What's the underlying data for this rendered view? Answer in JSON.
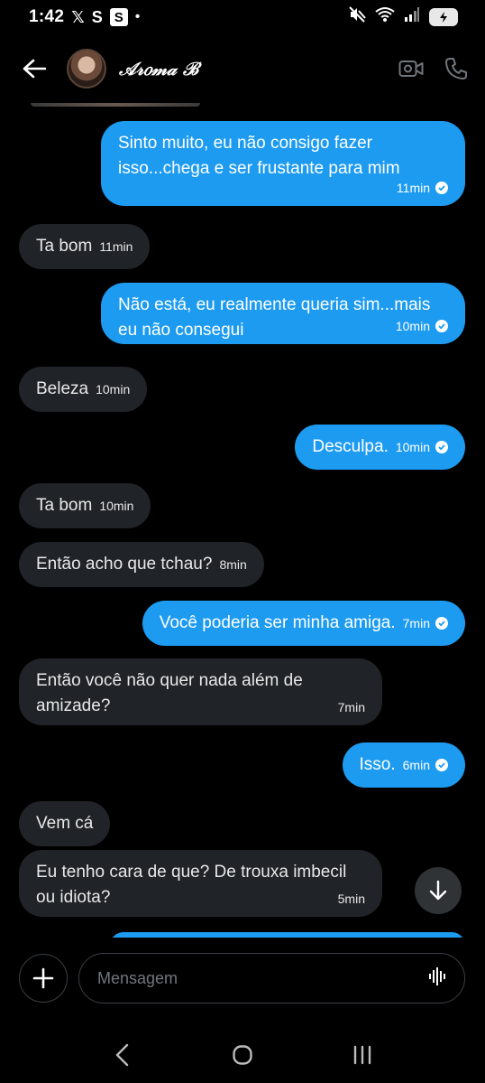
{
  "status_bar": {
    "time": "1:42",
    "icons": [
      "x-logo-icon",
      "s-icon",
      "s-box-icon",
      "dot-icon",
      "mute-icon",
      "wifi-icon",
      "signal-icon",
      "battery-icon"
    ],
    "glyph_x": "𝕏",
    "glyph_s": "S",
    "glyph_s_box": "S",
    "glyph_dot": "•"
  },
  "header": {
    "contact_name": "𝒜𝓇𝑜𝓂𝒶 ℬ",
    "icons": [
      "back-arrow-icon",
      "video-call-icon",
      "phone-icon"
    ]
  },
  "messages": [
    {
      "direction": "out",
      "text": "Sinto muito, eu não consigo fazer isso...chega e ser frustante para mim",
      "time": "11min",
      "read": true
    },
    {
      "direction": "in",
      "text": "Ta bom",
      "time": "11min"
    },
    {
      "direction": "out",
      "text": "Não está, eu realmente queria sim...mais eu não consegui",
      "time": "10min",
      "read": true
    },
    {
      "direction": "in",
      "text": "Beleza",
      "time": "10min"
    },
    {
      "direction": "out",
      "text": "Desculpa.",
      "time": "10min",
      "read": true
    },
    {
      "direction": "in",
      "text": "Ta bom",
      "time": "10min"
    },
    {
      "direction": "in",
      "text": "Então acho que tchau?",
      "time": "8min"
    },
    {
      "direction": "out",
      "text": "Você poderia ser minha amiga.",
      "time": "7min",
      "read": true
    },
    {
      "direction": "in",
      "text": "Então você não quer nada além de amizade?",
      "time": "7min"
    },
    {
      "direction": "out",
      "text": "Isso.",
      "time": "6min",
      "read": true
    },
    {
      "direction": "in",
      "text": "Vem cá",
      "time": ""
    },
    {
      "direction": "in",
      "text": "Eu tenho cara de que? De trouxa imbecil ou idiota?",
      "time": "5min"
    }
  ],
  "composer": {
    "placeholder": "Mensagem",
    "icons": [
      "plus-icon",
      "voice-wave-icon",
      "arrow-down-icon"
    ]
  },
  "nav_bar": {
    "icons": [
      "back-nav-icon",
      "home-nav-icon",
      "recents-nav-icon"
    ]
  },
  "colors": {
    "outgoing_bubble": "#1d9bf0",
    "incoming_bubble": "#202327",
    "background": "#000000"
  }
}
